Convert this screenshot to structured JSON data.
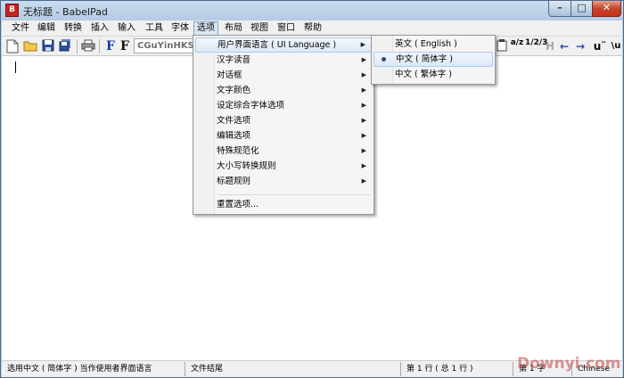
{
  "window": {
    "app_icon_text": "B",
    "title": "无标题 - BabelPad",
    "min_glyph": "–",
    "max_glyph": "□",
    "close_glyph": "✕"
  },
  "menubar": {
    "items": [
      "文件",
      "编辑",
      "转换",
      "插入",
      "输入",
      "工具",
      "字体",
      "选项",
      "布局",
      "视图",
      "窗口",
      "帮助"
    ],
    "active_index": 7
  },
  "toolbar": {
    "font_name": "CGuYinHKS",
    "font_btn_1": "F",
    "font_btn_2": "F",
    "right_icons": [
      "a/z",
      "1/2/3",
      "H",
      "←",
      "→",
      "u¨",
      "\\u"
    ]
  },
  "options_menu": {
    "items": [
      {
        "label": "用户界面语言 ( UI Language )",
        "submenu": true,
        "highlighted": true
      },
      {
        "label": "汉字读音",
        "submenu": true
      },
      {
        "label": "对话框",
        "submenu": true
      },
      {
        "label": "文字颜色",
        "submenu": true
      },
      {
        "label": "设定综合字体选项",
        "submenu": true
      },
      {
        "label": "文件选项",
        "submenu": true
      },
      {
        "label": "编辑选项",
        "submenu": true
      },
      {
        "label": "特殊规范化",
        "submenu": true
      },
      {
        "label": "大小写转换规则",
        "submenu": true
      },
      {
        "label": "标题规则",
        "submenu": true
      },
      {
        "label": "重置选项...",
        "submenu": false
      }
    ],
    "arrow_glyph": "▶"
  },
  "language_submenu": {
    "items": [
      {
        "label": "英文 ( English )",
        "selected": false
      },
      {
        "label": "中文 ( 简体字 )",
        "selected": true,
        "highlighted": true
      },
      {
        "label": "中文 ( 繁体字 )",
        "selected": false
      }
    ]
  },
  "statusbar": {
    "hint": "选用中文 ( 简体字 ) 当作使用者界面语言",
    "position_label": "文件结尾",
    "line_info": "第 1 行 ( 总 1 行 )",
    "column_info": "第 1 字",
    "language": "Chinese"
  },
  "watermark": "Downyi.com",
  "colors": {
    "title_gradient_top": "#c9dcef",
    "close_red": "#c7432a",
    "menu_highlight": "#dce9f7",
    "font_icon_blue": "#123ea3"
  }
}
